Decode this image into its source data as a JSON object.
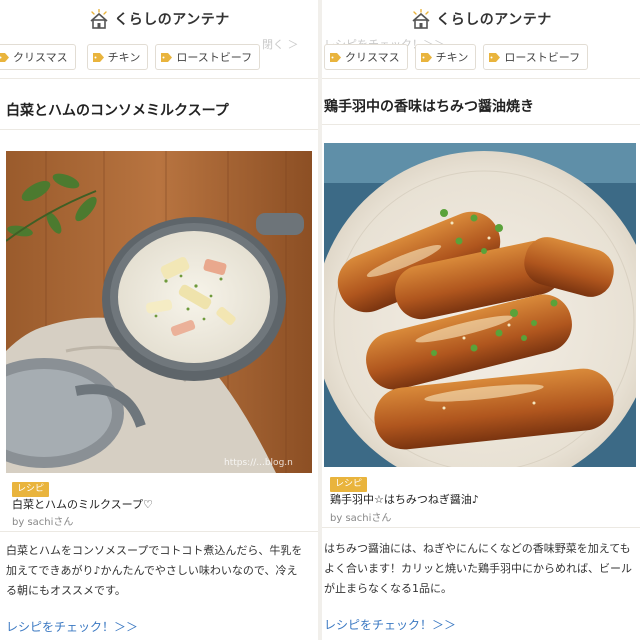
{
  "brand": {
    "name": "くらしのアンテナ"
  },
  "left": {
    "ghost_text": "閉く ＞",
    "tags": [
      "クリスマス",
      "チキン",
      "ローストビーフ"
    ],
    "title": "白菜とハムのコンソメミルクスープ",
    "watermark": "https://...blog.n",
    "badge": "レシピ",
    "recipe_name": "白菜とハムのミルクスープ♡",
    "author": "by sachiさん",
    "description": "白菜とハムをコンソメスープでコトコト煮込んだら、牛乳を加えてできあがり♪かんたんでやさしい味わいなので、冷える朝にもオススメです。",
    "link": "レシピをチェック！＞＞"
  },
  "right": {
    "ghost_text": "レシピをチェック！＞＞",
    "tags": [
      "クリスマス",
      "チキン",
      "ローストビーフ"
    ],
    "title": "鶏手羽中の香味はちみつ醤油焼き",
    "badge": "レシピ",
    "recipe_name": "鶏手羽中☆はちみつねぎ醤油♪",
    "author": "by sachiさん",
    "description": "はちみつ醤油には、ねぎやにんにくなどの香味野菜を加えてもよく合います！カリッと焼いた鶏手羽中にからめれば、ビールが止まらなくなる1品に。",
    "link": "レシピをチェック！＞＞"
  },
  "colors": {
    "accent": "#e9b43d",
    "link": "#3a78c2",
    "tag_icon": "#e9b43d"
  }
}
